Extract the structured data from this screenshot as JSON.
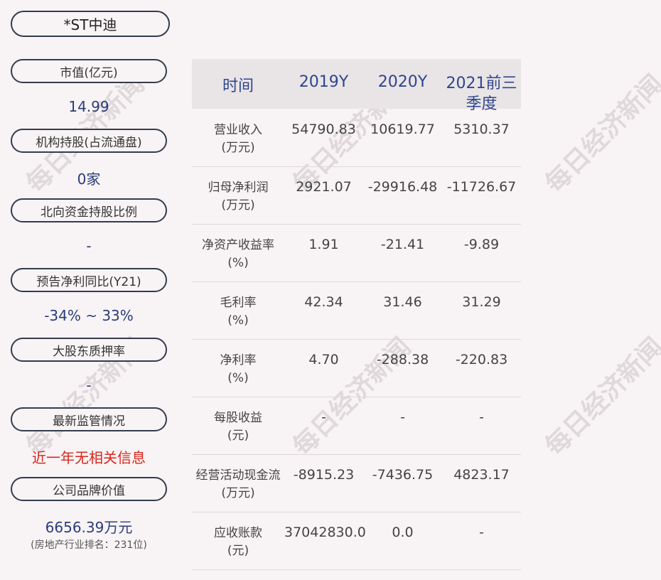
{
  "stock_name": "*ST中迪",
  "metrics": [
    {
      "label": "市值(亿元)",
      "value": "14.99"
    },
    {
      "label": "机构持股(占流通盘)",
      "value": "0家"
    },
    {
      "label": "北向资金持股比例",
      "value": "-"
    },
    {
      "label": "预告净利同比(Y21)",
      "value": "-34% ~ 33%"
    },
    {
      "label": "大股东质押率",
      "value": "-"
    },
    {
      "label": "最新监管情况",
      "value": "近一年无相关信息"
    },
    {
      "label": "公司品牌价值",
      "value": "6656.39万元",
      "note": "(房地产行业排名：231位)"
    }
  ],
  "table": {
    "headers": [
      "时间",
      "2019Y",
      "2020Y",
      "2021前三",
      "季度"
    ],
    "rows": [
      {
        "label1": "营业收入",
        "label2": "(万元)",
        "values": [
          "54790.83",
          "10619.77",
          "5310.37"
        ]
      },
      {
        "label1": "归母净利润",
        "label2": "(万元)",
        "values": [
          "2921.07",
          "-29916.48",
          "-11726.67"
        ]
      },
      {
        "label1": "净资产收益率",
        "label2": "(%)",
        "values": [
          "1.91",
          "-21.41",
          "-9.89"
        ]
      },
      {
        "label1": "毛利率",
        "label2": "(%)",
        "values": [
          "42.34",
          "31.46",
          "31.29"
        ]
      },
      {
        "label1": "净利率",
        "label2": "(%)",
        "values": [
          "4.70",
          "-288.38",
          "-220.83"
        ]
      },
      {
        "label1": "每股收益",
        "label2": "(元)",
        "values": [
          "-",
          "-",
          "-"
        ]
      },
      {
        "label1": "经营活动现金流",
        "label2": "(万元)",
        "values": [
          "-8915.23",
          "-7436.75",
          "4823.17"
        ]
      },
      {
        "label1": "应收账款",
        "label2": "(元)",
        "values": [
          "37042830.0",
          "0.0",
          "-"
        ]
      }
    ]
  },
  "watermark": "每日经济新闻",
  "colors": {
    "background": "#f8f3f4",
    "value_blue": "#2a3d7a",
    "header_blue": "#2e468c",
    "alert_red": "#d9261c",
    "header_bg": "#e9e4e6"
  }
}
